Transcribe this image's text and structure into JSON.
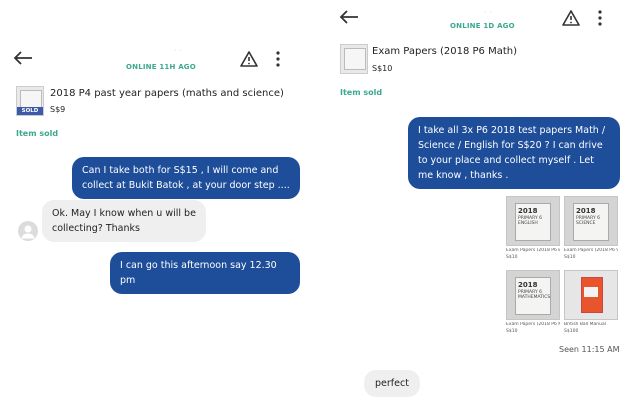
{
  "left": {
    "status": "ONLINE 11H AGO",
    "listing": {
      "title": "2018 P4 past year papers (maths and science)",
      "price": "S$9",
      "tag": "SOLD"
    },
    "item_status": "Item sold",
    "messages": [
      {
        "dir": "out",
        "text": "Can I take both for S$15 , I will come and collect at Bukit Batok , at your door step ...."
      },
      {
        "dir": "in",
        "text": "Ok. May I know when u will be collecting? Thanks"
      },
      {
        "dir": "out",
        "text": "I can go this afternoon say 12.30 pm"
      }
    ]
  },
  "right": {
    "status": "ONLINE 1D AGO",
    "listing": {
      "title": "Exam Papers (2018 P6 Math)",
      "price": "S$10"
    },
    "item_status": "Item sold",
    "message": "I take all 3x P6 2018 test papers Math / Science / English for S$20 ? I can drive to your place and collect myself . Let me know , thanks .",
    "attachments": [
      {
        "cover_year": "2018",
        "cover_subject": "PRIMARY 6 ENGLISH",
        "caption": "Exam Papers (2018 P6 En...",
        "price": "S$10"
      },
      {
        "cover_year": "2018",
        "cover_subject": "PRIMARY 6 SCIENCE",
        "caption": "Exam Papers (2018 P6 Sc...",
        "price": "S$10"
      },
      {
        "cover_year": "2018",
        "cover_subject": "PRIMARY 6 MATHEMATICS",
        "caption": "Exam Papers (2018 P6 Ma...",
        "price": "S$10"
      },
      {
        "cover_year": "",
        "cover_subject": "",
        "caption": "British Ball Manual",
        "price": "S$100"
      }
    ],
    "seen": "Seen 11:15 AM",
    "reply": "perfect"
  },
  "colors": {
    "accent": "#3aa98c",
    "bubble_out": "#1e4d9a",
    "bubble_in": "#efefef"
  },
  "icons": [
    "back-arrow-icon",
    "warning-triangle-icon",
    "more-vert-icon",
    "user-avatar-icon"
  ]
}
